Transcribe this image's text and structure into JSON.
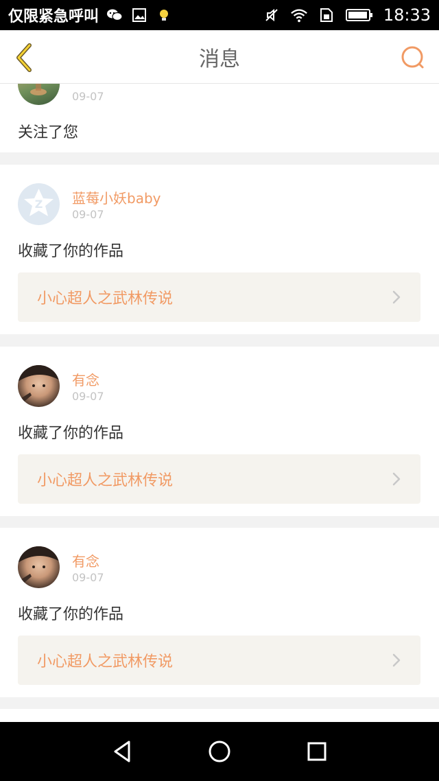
{
  "status_bar": {
    "left_text": "仅限紧急呼叫",
    "time": "18:33",
    "icons": [
      "wechat-icon",
      "image-icon",
      "bulb-icon",
      "mute-icon",
      "wifi-icon",
      "sim-icon",
      "battery-icon"
    ]
  },
  "header": {
    "title": "消息",
    "back_icon": "chevron-left-icon",
    "search_icon": "search-icon",
    "accent": "#f19a64"
  },
  "messages": [
    {
      "name": "",
      "date": "09-07",
      "action": "关注了您",
      "work": null
    },
    {
      "name": "蓝莓小妖baby",
      "date": "09-07",
      "action": "收藏了你的作品",
      "work": "小心超人之武林传说"
    },
    {
      "name": "有念",
      "date": "09-07",
      "action": "收藏了你的作品",
      "work": "小心超人之武林传说"
    },
    {
      "name": "有念",
      "date": "09-07",
      "action": "收藏了你的作品",
      "work": "小心超人之武林传说"
    }
  ],
  "navigation": {
    "back": "triangle-back-icon",
    "home": "circle-home-icon",
    "recents": "square-recents-icon"
  }
}
